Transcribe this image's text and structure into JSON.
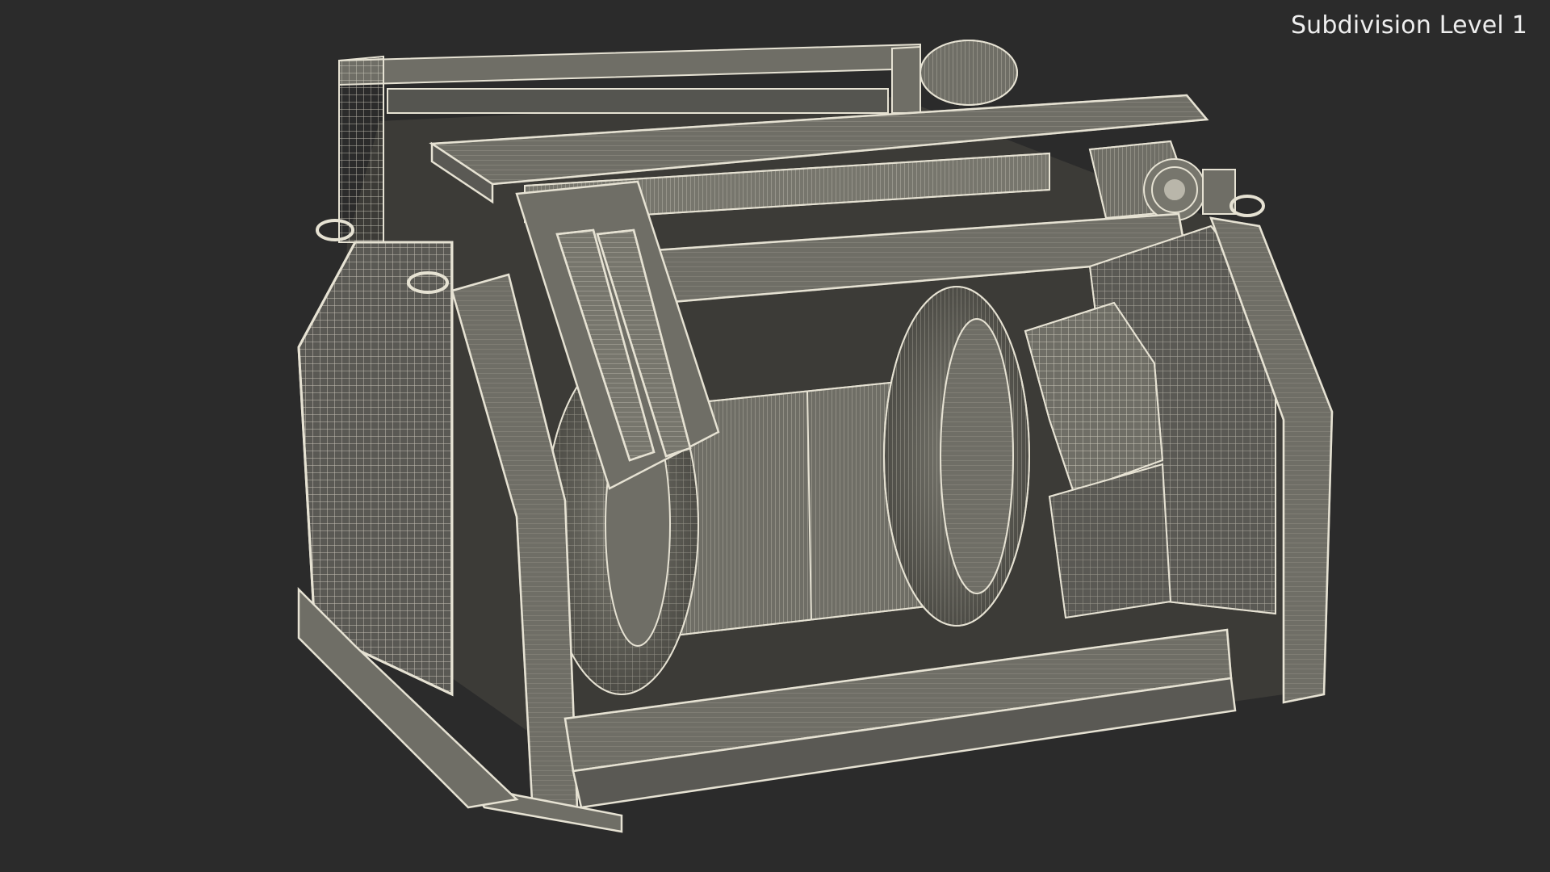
{
  "viewport": {
    "label": "Subdivision Level 1",
    "background_color": "#2b2b2b",
    "model_fill_color": "#6f6e66",
    "wire_color": "#e6e2d3"
  },
  "model": {
    "description_icon": "winch-wireframe-icon"
  }
}
